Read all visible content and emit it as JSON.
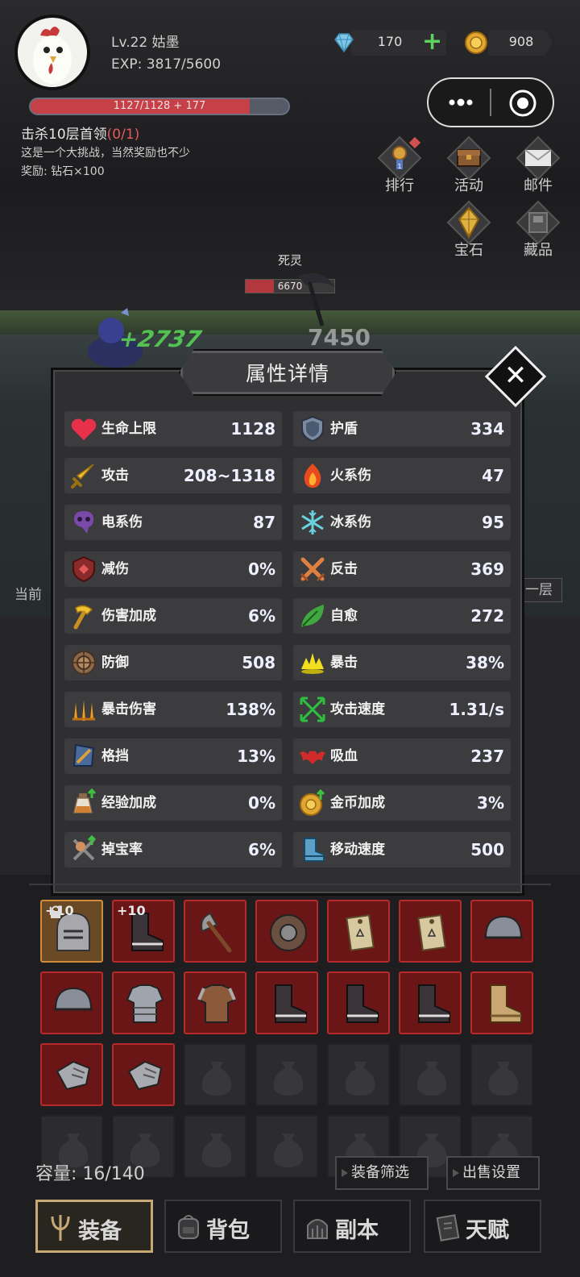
{
  "player": {
    "level_name": "Lv.22 姑墨",
    "exp": "EXP: 3817/5600",
    "hp_text": "1127/1128 + 177",
    "hp_fraction": 0.85
  },
  "quest": {
    "title": "击杀10层首领",
    "progress": "(0/1)",
    "desc": "这是一个大挑战，当然奖励也不少",
    "reward": "奖励: 钻石×100"
  },
  "currency": {
    "gems": "170",
    "gold": "908",
    "plus_icon": "plus-icon"
  },
  "menu": [
    {
      "label": "排行",
      "icon": "trophy-icon",
      "rank": "1"
    },
    {
      "label": "活动",
      "icon": "chest-icon"
    },
    {
      "label": "邮件",
      "icon": "mail-icon"
    },
    {
      "label": "宝石",
      "icon": "gem-icon"
    },
    {
      "label": "藏品",
      "icon": "collection-icon"
    }
  ],
  "battle": {
    "enemy_name": "死灵",
    "enemy_hp": "6670",
    "enemy_hp_fraction": 0.32,
    "heal_number": "+2737",
    "damage_number": "7450"
  },
  "side": {
    "left_label": "当前",
    "right_label": "一层"
  },
  "modal": {
    "title": "属性详情",
    "left": [
      {
        "name": "生命上限",
        "value": "1128",
        "icon": "heart-icon"
      },
      {
        "name": "攻击",
        "value": "208~1318",
        "icon": "sword-icon"
      },
      {
        "name": "电系伤",
        "value": "87",
        "icon": "lightning-skull-icon"
      },
      {
        "name": "减伤",
        "value": "0%",
        "icon": "shield-reduction-icon"
      },
      {
        "name": "伤害加成",
        "value": "6%",
        "icon": "hammer-icon"
      },
      {
        "name": "防御",
        "value": "508",
        "icon": "round-shield-icon"
      },
      {
        "name": "暴击伤害",
        "value": "138%",
        "icon": "flame-swords-icon"
      },
      {
        "name": "格挡",
        "value": "13%",
        "icon": "block-shield-icon"
      },
      {
        "name": "经验加成",
        "value": "0%",
        "icon": "exp-potion-icon"
      },
      {
        "name": "掉宝率",
        "value": "6%",
        "icon": "loot-icon"
      }
    ],
    "right": [
      {
        "name": "护盾",
        "value": "334",
        "icon": "shield-icon"
      },
      {
        "name": "火系伤",
        "value": "47",
        "icon": "fire-icon"
      },
      {
        "name": "冰系伤",
        "value": "95",
        "icon": "snowflake-icon"
      },
      {
        "name": "反击",
        "value": "369",
        "icon": "crossed-swords-icon"
      },
      {
        "name": "自愈",
        "value": "272",
        "icon": "leaf-icon"
      },
      {
        "name": "暴击",
        "value": "38%",
        "icon": "crit-burst-icon"
      },
      {
        "name": "攻击速度",
        "value": "1.31/s",
        "icon": "arrows-icon"
      },
      {
        "name": "吸血",
        "value": "237",
        "icon": "bat-icon"
      },
      {
        "name": "金币加成",
        "value": "3%",
        "icon": "gold-coin-icon"
      },
      {
        "name": "移动速度",
        "value": "500",
        "icon": "boot-icon"
      }
    ]
  },
  "inventory": {
    "capacity": "容量: 16/140",
    "slots": [
      {
        "item": "helmet-icon",
        "rarity": "gold",
        "label": "+10",
        "locked": true
      },
      {
        "item": "boot-icon",
        "rarity": "red",
        "label": "+10"
      },
      {
        "item": "axe-icon",
        "rarity": "red"
      },
      {
        "item": "round-shield-icon",
        "rarity": "red"
      },
      {
        "item": "tag-icon",
        "rarity": "red"
      },
      {
        "item": "tag-icon",
        "rarity": "red"
      },
      {
        "item": "cap-helmet-icon",
        "rarity": "red"
      },
      {
        "item": "cap-helmet-icon",
        "rarity": "red"
      },
      {
        "item": "chest-armor-icon",
        "rarity": "red"
      },
      {
        "item": "leather-armor-icon",
        "rarity": "red"
      },
      {
        "item": "boot-icon",
        "rarity": "red"
      },
      {
        "item": "boot-icon",
        "rarity": "red"
      },
      {
        "item": "boot-icon",
        "rarity": "red"
      },
      {
        "item": "tan-boot-icon",
        "rarity": "red"
      },
      {
        "item": "gauntlet-icon",
        "rarity": "red"
      },
      {
        "item": "gauntlet-icon",
        "rarity": "red"
      }
    ],
    "filter_button": "装备筛选",
    "sell_button": "出售设置"
  },
  "tabs": [
    {
      "label": "装备",
      "icon": "trident-icon",
      "active": true
    },
    {
      "label": "背包",
      "icon": "backpack-icon",
      "active": false
    },
    {
      "label": "副本",
      "icon": "dungeon-gate-icon",
      "active": false
    },
    {
      "label": "天赋",
      "icon": "book-icon",
      "active": false
    }
  ],
  "colors": {
    "rarity_red": "#6a1617",
    "rarity_gold": "#6a4a24",
    "hp_red": "#c64048",
    "panel": "#2f2f31",
    "tab_active_border": "#c7a976"
  }
}
